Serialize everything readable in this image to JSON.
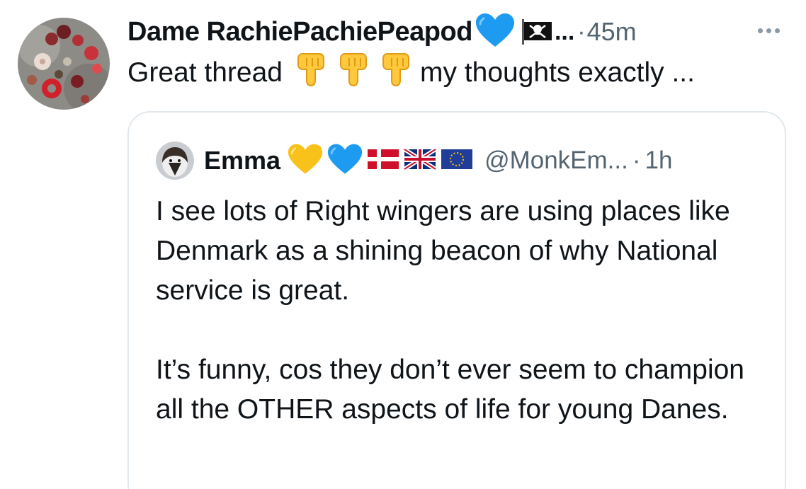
{
  "tweet": {
    "author": {
      "display_name": "Dame RachiePachiePeapod",
      "badges": [
        "blue-heart-emoji",
        "pirate-flag-emoji"
      ],
      "truncation": "...",
      "separator": "·",
      "timestamp": "45m"
    },
    "text_before": "Great thread",
    "emoji_fingers": [
      "backhand-index-pointing-down",
      "backhand-index-pointing-down",
      "backhand-index-pointing-down"
    ],
    "text_after": "my thoughts exactly ..."
  },
  "quote": {
    "display_name": "Emma",
    "badges": [
      "yellow-heart-emoji",
      "blue-heart-emoji",
      "denmark-flag-emoji",
      "uk-flag-emoji",
      "eu-flag-emoji"
    ],
    "handle": "@MonkEm...",
    "separator": "·",
    "timestamp": "1h",
    "paragraph_1": "I see lots of Right wingers are using places like Denmark as a shining beacon of why National service is great.",
    "paragraph_2": "It’s funny, cos they don’t ever seem to champion all the OTHER aspects of life for young Danes."
  },
  "colors": {
    "text_primary": "#0f1419",
    "text_secondary": "#536471",
    "card_border": "#e1e8ed",
    "blue_heart": "#1d9bf0",
    "yellow_heart": "#f9c21a"
  }
}
